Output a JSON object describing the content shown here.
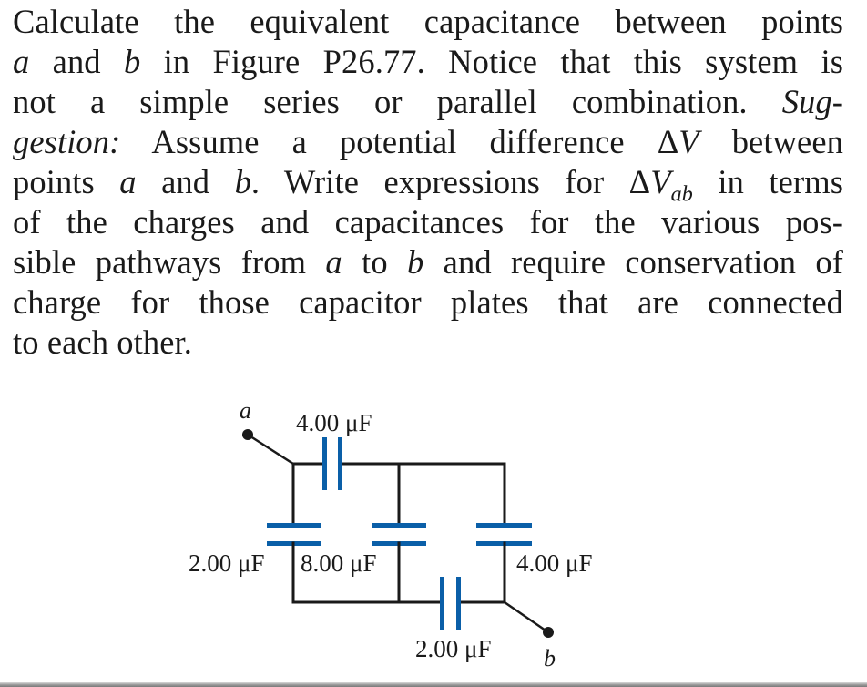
{
  "problem": {
    "lines": [
      {
        "segments": [
          {
            "text": "Calculate the equivalent capacitance between points",
            "style": "normal"
          }
        ]
      },
      {
        "segments": [
          {
            "text": "a",
            "style": "italic"
          },
          {
            "text": " and ",
            "style": "normal"
          },
          {
            "text": "b",
            "style": "italic"
          },
          {
            "text": " in Figure P26.77. Notice that this system is",
            "style": "normal"
          }
        ]
      },
      {
        "segments": [
          {
            "text": "not a simple series or parallel combination. ",
            "style": "normal"
          },
          {
            "text": "Sug-",
            "style": "italic"
          }
        ]
      },
      {
        "segments": [
          {
            "text": "gestion:",
            "style": "italic"
          },
          {
            "text": " Assume a potential difference Δ",
            "style": "normal"
          },
          {
            "text": "V",
            "style": "italic"
          },
          {
            "text": " between",
            "style": "normal"
          }
        ]
      },
      {
        "segments": [
          {
            "text": "points ",
            "style": "normal"
          },
          {
            "text": "a",
            "style": "italic"
          },
          {
            "text": " and ",
            "style": "normal"
          },
          {
            "text": "b",
            "style": "italic"
          },
          {
            "text": ". Write expressions for Δ",
            "style": "normal"
          },
          {
            "text": "V",
            "style": "italic"
          },
          {
            "text": "ab",
            "style": "sub"
          },
          {
            "text": " in terms",
            "style": "normal"
          }
        ]
      },
      {
        "segments": [
          {
            "text": "of the charges and capacitances for the various pos-",
            "style": "normal"
          }
        ]
      },
      {
        "segments": [
          {
            "text": "sible pathways from ",
            "style": "normal"
          },
          {
            "text": "a",
            "style": "italic"
          },
          {
            "text": " to ",
            "style": "normal"
          },
          {
            "text": "b",
            "style": "italic"
          },
          {
            "text": " and require conservation of",
            "style": "normal"
          }
        ]
      },
      {
        "segments": [
          {
            "text": "charge for those capacitor plates that are connected",
            "style": "normal"
          }
        ]
      },
      {
        "segments": [
          {
            "text": "to each other.",
            "style": "normal"
          }
        ]
      }
    ]
  },
  "figure": {
    "id": "Figure P26.77",
    "accent_color": "#0a5fa8",
    "points": {
      "a": "a",
      "b": "b"
    },
    "capacitors": {
      "top": {
        "value": "4.00 μF",
        "orientation": "horizontal"
      },
      "left": {
        "value": "2.00 μF",
        "orientation": "vertical"
      },
      "middle": {
        "value": "8.00 μF",
        "orientation": "vertical"
      },
      "right": {
        "value": "4.00 μF",
        "orientation": "vertical"
      },
      "bottom": {
        "value": "2.00 μF",
        "orientation": "horizontal"
      }
    }
  }
}
